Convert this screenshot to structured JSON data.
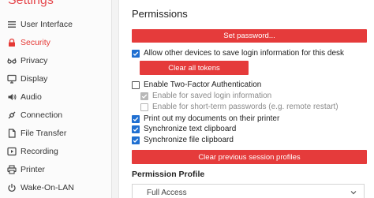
{
  "app": {
    "title": "Settings"
  },
  "sidebar": {
    "items": [
      {
        "label": "User Interface",
        "icon": "list-icon",
        "active": false
      },
      {
        "label": "Security",
        "icon": "lock-icon",
        "active": true
      },
      {
        "label": "Privacy",
        "icon": "glasses-icon",
        "active": false
      },
      {
        "label": "Display",
        "icon": "monitor-icon",
        "active": false
      },
      {
        "label": "Audio",
        "icon": "speaker-icon",
        "active": false
      },
      {
        "label": "Connection",
        "icon": "connection-icon",
        "active": false
      },
      {
        "label": "File Transfer",
        "icon": "file-icon",
        "active": false
      },
      {
        "label": "Recording",
        "icon": "play-icon",
        "active": false
      },
      {
        "label": "Printer",
        "icon": "printer-icon",
        "active": false
      },
      {
        "label": "Wake-On-LAN",
        "icon": "power-icon",
        "active": false
      }
    ]
  },
  "permissions": {
    "title": "Permissions",
    "set_password_label": "Set password...",
    "allow_save_login": {
      "label": "Allow other devices to save login information for this desk",
      "checked": true
    },
    "clear_tokens_label": "Clear all tokens",
    "two_factor": {
      "label": "Enable Two-Factor Authentication",
      "checked": false
    },
    "saved_login": {
      "label": "Enable for saved login information",
      "checked": true,
      "disabled": true
    },
    "short_term": {
      "label": "Enable for short-term passwords (e.g. remote restart)",
      "checked": false,
      "disabled": true
    },
    "print_out": {
      "label": "Print out my documents on their printer",
      "checked": true
    },
    "sync_text": {
      "label": "Synchronize text clipboard",
      "checked": true
    },
    "sync_file": {
      "label": "Synchronize file clipboard",
      "checked": true
    },
    "clear_profiles_label": "Clear previous session profiles",
    "profile_title": "Permission Profile",
    "profile_value": "Full Access"
  },
  "colors": {
    "accent": "#e53b3b",
    "checkbox": "#1f6fd1"
  }
}
